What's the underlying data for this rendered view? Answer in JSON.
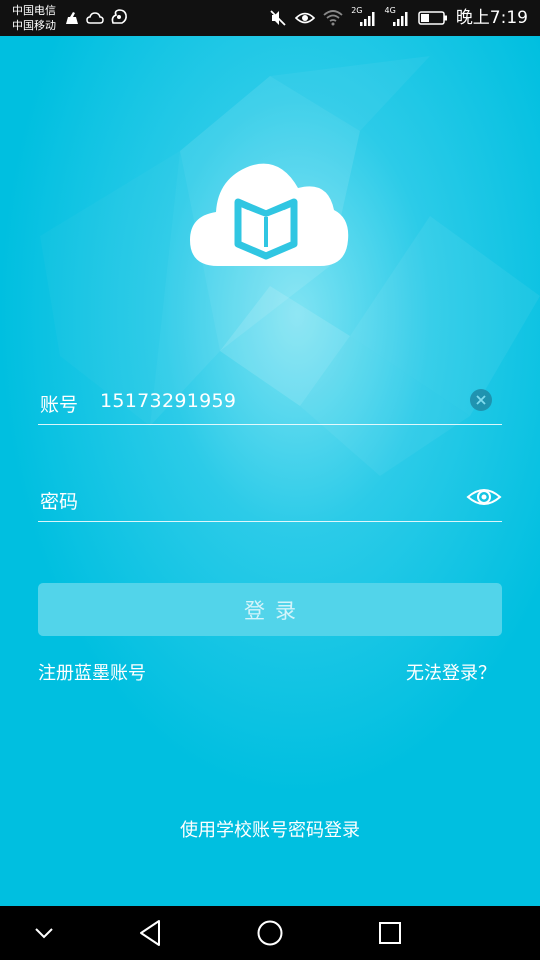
{
  "status_bar": {
    "carrier_1": "中国电信",
    "carrier_2": "中国移动",
    "network_1": "2G",
    "network_2": "4G",
    "time": "晚上7:19",
    "icons": [
      "cleaner-icon",
      "weather-cloud-icon",
      "squirrel-app-icon",
      "mute-icon",
      "eye-comfort-icon",
      "wifi-icon",
      "signal-2g-icon",
      "signal-4g-icon",
      "battery-icon"
    ]
  },
  "login": {
    "account_label": "账号",
    "account_value": "15173291959",
    "password_label": "密码",
    "login_button": "登录",
    "register_link": "注册蓝墨账号",
    "forgot_link": "无法登录？",
    "school_login": "使用学校账号密码登录"
  },
  "nav": {
    "buttons": [
      "collapse-icon",
      "back-icon",
      "home-icon",
      "recents-icon"
    ]
  },
  "colors": {
    "background": "#00bfe0",
    "button": "#52d4ea",
    "status_bar": "#111111",
    "nav_bar": "#000000"
  }
}
